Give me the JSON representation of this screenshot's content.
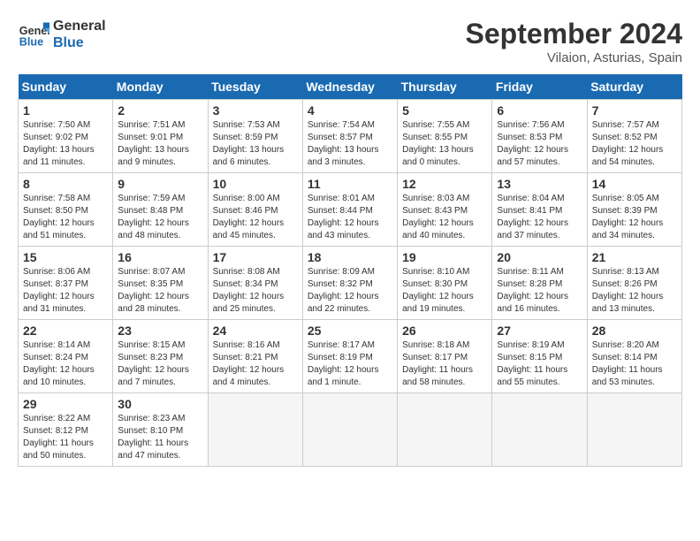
{
  "header": {
    "logo_general": "General",
    "logo_blue": "Blue",
    "month_title": "September 2024",
    "subtitle": "Vilaion, Asturias, Spain"
  },
  "calendar": {
    "days_of_week": [
      "Sunday",
      "Monday",
      "Tuesday",
      "Wednesday",
      "Thursday",
      "Friday",
      "Saturday"
    ],
    "weeks": [
      [
        null,
        {
          "day": "2",
          "sunrise": "Sunrise: 7:51 AM",
          "sunset": "Sunset: 9:01 PM",
          "daylight": "Daylight: 13 hours and 9 minutes."
        },
        {
          "day": "3",
          "sunrise": "Sunrise: 7:53 AM",
          "sunset": "Sunset: 8:59 PM",
          "daylight": "Daylight: 13 hours and 6 minutes."
        },
        {
          "day": "4",
          "sunrise": "Sunrise: 7:54 AM",
          "sunset": "Sunset: 8:57 PM",
          "daylight": "Daylight: 13 hours and 3 minutes."
        },
        {
          "day": "5",
          "sunrise": "Sunrise: 7:55 AM",
          "sunset": "Sunset: 8:55 PM",
          "daylight": "Daylight: 13 hours and 0 minutes."
        },
        {
          "day": "6",
          "sunrise": "Sunrise: 7:56 AM",
          "sunset": "Sunset: 8:53 PM",
          "daylight": "Daylight: 12 hours and 57 minutes."
        },
        {
          "day": "7",
          "sunrise": "Sunrise: 7:57 AM",
          "sunset": "Sunset: 8:52 PM",
          "daylight": "Daylight: 12 hours and 54 minutes."
        }
      ],
      [
        {
          "day": "1",
          "sunrise": "Sunrise: 7:50 AM",
          "sunset": "Sunset: 9:02 PM",
          "daylight": "Daylight: 13 hours and 11 minutes."
        },
        {
          "day": "9",
          "sunrise": "Sunrise: 7:59 AM",
          "sunset": "Sunset: 8:48 PM",
          "daylight": "Daylight: 12 hours and 48 minutes."
        },
        {
          "day": "10",
          "sunrise": "Sunrise: 8:00 AM",
          "sunset": "Sunset: 8:46 PM",
          "daylight": "Daylight: 12 hours and 45 minutes."
        },
        {
          "day": "11",
          "sunrise": "Sunrise: 8:01 AM",
          "sunset": "Sunset: 8:44 PM",
          "daylight": "Daylight: 12 hours and 43 minutes."
        },
        {
          "day": "12",
          "sunrise": "Sunrise: 8:03 AM",
          "sunset": "Sunset: 8:43 PM",
          "daylight": "Daylight: 12 hours and 40 minutes."
        },
        {
          "day": "13",
          "sunrise": "Sunrise: 8:04 AM",
          "sunset": "Sunset: 8:41 PM",
          "daylight": "Daylight: 12 hours and 37 minutes."
        },
        {
          "day": "14",
          "sunrise": "Sunrise: 8:05 AM",
          "sunset": "Sunset: 8:39 PM",
          "daylight": "Daylight: 12 hours and 34 minutes."
        }
      ],
      [
        {
          "day": "8",
          "sunrise": "Sunrise: 7:58 AM",
          "sunset": "Sunset: 8:50 PM",
          "daylight": "Daylight: 12 hours and 51 minutes."
        },
        {
          "day": "16",
          "sunrise": "Sunrise: 8:07 AM",
          "sunset": "Sunset: 8:35 PM",
          "daylight": "Daylight: 12 hours and 28 minutes."
        },
        {
          "day": "17",
          "sunrise": "Sunrise: 8:08 AM",
          "sunset": "Sunset: 8:34 PM",
          "daylight": "Daylight: 12 hours and 25 minutes."
        },
        {
          "day": "18",
          "sunrise": "Sunrise: 8:09 AM",
          "sunset": "Sunset: 8:32 PM",
          "daylight": "Daylight: 12 hours and 22 minutes."
        },
        {
          "day": "19",
          "sunrise": "Sunrise: 8:10 AM",
          "sunset": "Sunset: 8:30 PM",
          "daylight": "Daylight: 12 hours and 19 minutes."
        },
        {
          "day": "20",
          "sunrise": "Sunrise: 8:11 AM",
          "sunset": "Sunset: 8:28 PM",
          "daylight": "Daylight: 12 hours and 16 minutes."
        },
        {
          "day": "21",
          "sunrise": "Sunrise: 8:13 AM",
          "sunset": "Sunset: 8:26 PM",
          "daylight": "Daylight: 12 hours and 13 minutes."
        }
      ],
      [
        {
          "day": "15",
          "sunrise": "Sunrise: 8:06 AM",
          "sunset": "Sunset: 8:37 PM",
          "daylight": "Daylight: 12 hours and 31 minutes."
        },
        {
          "day": "23",
          "sunrise": "Sunrise: 8:15 AM",
          "sunset": "Sunset: 8:23 PM",
          "daylight": "Daylight: 12 hours and 7 minutes."
        },
        {
          "day": "24",
          "sunrise": "Sunrise: 8:16 AM",
          "sunset": "Sunset: 8:21 PM",
          "daylight": "Daylight: 12 hours and 4 minutes."
        },
        {
          "day": "25",
          "sunrise": "Sunrise: 8:17 AM",
          "sunset": "Sunset: 8:19 PM",
          "daylight": "Daylight: 12 hours and 1 minute."
        },
        {
          "day": "26",
          "sunrise": "Sunrise: 8:18 AM",
          "sunset": "Sunset: 8:17 PM",
          "daylight": "Daylight: 11 hours and 58 minutes."
        },
        {
          "day": "27",
          "sunrise": "Sunrise: 8:19 AM",
          "sunset": "Sunset: 8:15 PM",
          "daylight": "Daylight: 11 hours and 55 minutes."
        },
        {
          "day": "28",
          "sunrise": "Sunrise: 8:20 AM",
          "sunset": "Sunset: 8:14 PM",
          "daylight": "Daylight: 11 hours and 53 minutes."
        }
      ],
      [
        {
          "day": "22",
          "sunrise": "Sunrise: 8:14 AM",
          "sunset": "Sunset: 8:24 PM",
          "daylight": "Daylight: 12 hours and 10 minutes."
        },
        {
          "day": "30",
          "sunrise": "Sunrise: 8:23 AM",
          "sunset": "Sunset: 8:10 PM",
          "daylight": "Daylight: 11 hours and 47 minutes."
        },
        null,
        null,
        null,
        null,
        null
      ],
      [
        {
          "day": "29",
          "sunrise": "Sunrise: 8:22 AM",
          "sunset": "Sunset: 8:12 PM",
          "daylight": "Daylight: 11 hours and 50 minutes."
        },
        null,
        null,
        null,
        null,
        null,
        null
      ]
    ]
  }
}
